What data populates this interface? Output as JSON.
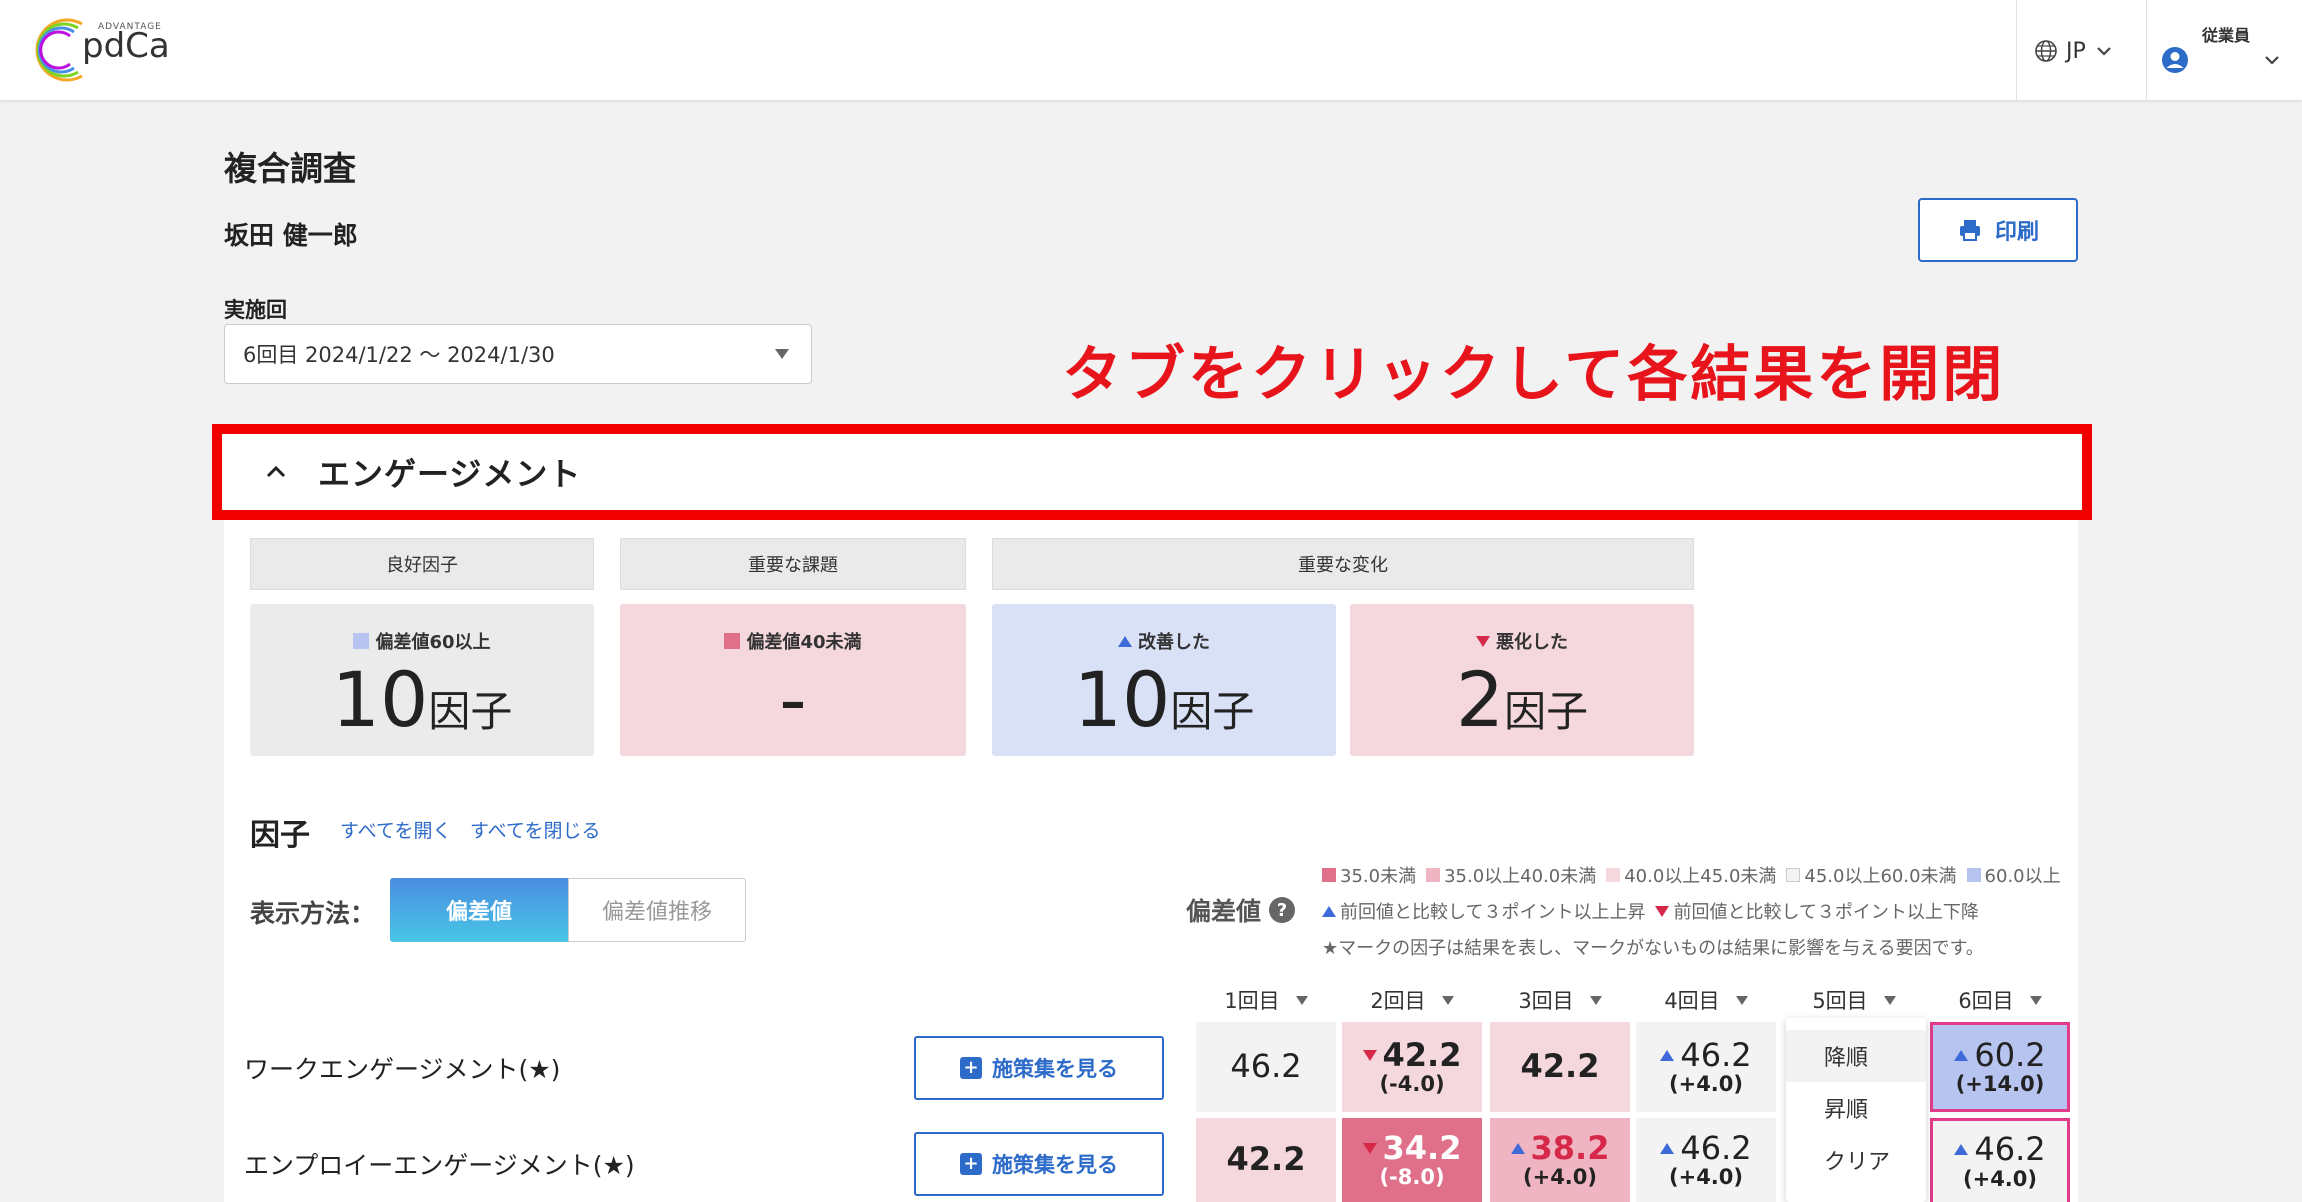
{
  "header": {
    "logo_small": "ADVANTAGE",
    "logo_text": "pdCa",
    "language": "JP",
    "user_label": "従業員"
  },
  "page": {
    "title": "複合調査",
    "user_name": "坂田 健一郎",
    "print_label": "印刷",
    "round_label": "実施回",
    "round_value": "6回目  2024/1/22 〜 2024/1/30",
    "annotation": "タブをクリックして各結果を開閉"
  },
  "section": {
    "title": "エンゲージメント",
    "categories": [
      "良好因子",
      "重要な課題",
      "重要な変化"
    ],
    "stats": [
      {
        "label": "偏差値60以上",
        "value": "10",
        "unit": "因子"
      },
      {
        "label": "偏差値40未満",
        "value": "-",
        "unit": ""
      },
      {
        "label": "改善した",
        "value": "10",
        "unit": "因子"
      },
      {
        "label": "悪化した",
        "value": "2",
        "unit": "因子"
      }
    ]
  },
  "factors": {
    "title": "因子",
    "open_all": "すべてを開く",
    "close_all": "すべてを閉じる",
    "display_label": "表示方法：",
    "toggle_on": "偏差値",
    "toggle_off": "偏差値推移",
    "dev_label": "偏差値",
    "legend_ranges": [
      "35.0未満",
      "35.0以上40.0未満",
      "40.0以上45.0未満",
      "45.0以上60.0未満",
      "60.0以上"
    ],
    "legend_up": "前回値と比較して３ポイント以上上昇",
    "legend_down": "前回値と比較して３ポイント以上下降",
    "legend_note": "★マークの因子は結果を表し、マークがないものは結果に影響を与える要因です。",
    "columns": [
      "1回目",
      "2回目",
      "3回目",
      "4回目",
      "5回目",
      "6回目"
    ],
    "measure_label": "施策集を見る",
    "rows": [
      {
        "name": "ワークエンゲージメント(★)",
        "cells": [
          {
            "v": "46.2",
            "d": ""
          },
          {
            "v": "42.2",
            "d": "(-4.0)"
          },
          {
            "v": "42.2",
            "d": ""
          },
          {
            "v": "46.2",
            "d": "(+4.0)"
          },
          {
            "v": "",
            "d": ""
          },
          {
            "v": "60.2",
            "d": "(+14.0)"
          }
        ]
      },
      {
        "name": "エンプロイーエンゲージメント(★)",
        "cells": [
          {
            "v": "42.2",
            "d": ""
          },
          {
            "v": "34.2",
            "d": "(-8.0)"
          },
          {
            "v": "38.2",
            "d": "(+4.0)"
          },
          {
            "v": "46.2",
            "d": "(+4.0)"
          },
          {
            "v": "",
            "d": ""
          },
          {
            "v": "46.2",
            "d": "(+4.0)"
          }
        ]
      }
    ],
    "sort_menu": [
      "降順",
      "昇順",
      "クリア"
    ]
  },
  "colors": {
    "lt35": "#e0708a",
    "r35_40": "#efb5c3",
    "r40_45": "#f5d7de",
    "r45_60": "#f3f3f3",
    "ge60": "#b7c4f0",
    "up": "#3d6ad6",
    "down": "#d6294a",
    "accent": "#2d6bc9"
  }
}
